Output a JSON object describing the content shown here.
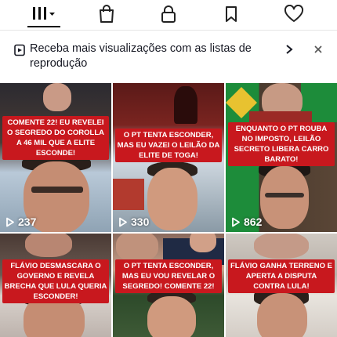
{
  "tabs": [
    {
      "name": "videos-tab",
      "icon": "grid-icon"
    },
    {
      "name": "shop-tab",
      "icon": "shopping-bag-icon"
    },
    {
      "name": "private-tab",
      "icon": "lock-icon"
    },
    {
      "name": "saved-tab",
      "icon": "bookmark-icon"
    },
    {
      "name": "liked-tab",
      "icon": "heart-icon"
    }
  ],
  "banner": {
    "text": "Receba mais visualizações com as listas de reprodução",
    "icon": "playlist-icon"
  },
  "videos": [
    {
      "caption": "COMENTE 22! EU REVELEI O SEGREDO DO COROLLA A 46 MIL QUE A ELITE ESCONDE!",
      "views": "237"
    },
    {
      "caption": "O PT TENTA ESCONDER, MAS EU VAZEI O LEILÃO DA ELITE DE TOGA!",
      "views": "330"
    },
    {
      "caption": "ENQUANTO O PT ROUBA NO IMPOSTO, LEILÃO SECRETO LIBERA CARRO BARATO!",
      "views": "862"
    },
    {
      "caption": "FLÁVIO DESMASCARA O GOVERNO E REVELA BRECHA QUE LULA QUERIA ESCONDER!",
      "views": ""
    },
    {
      "caption": "O PT TENTA ESCONDER, MAS EU VOU REVELAR O SEGREDO! COMENTE 22!",
      "views": ""
    },
    {
      "caption": "FLÁVIO GANHA TERRENO E APERTA A DISPUTA CONTRA LULA!",
      "views": ""
    }
  ],
  "colors": {
    "caption_bg": "#c8181e",
    "text": "#161823"
  }
}
